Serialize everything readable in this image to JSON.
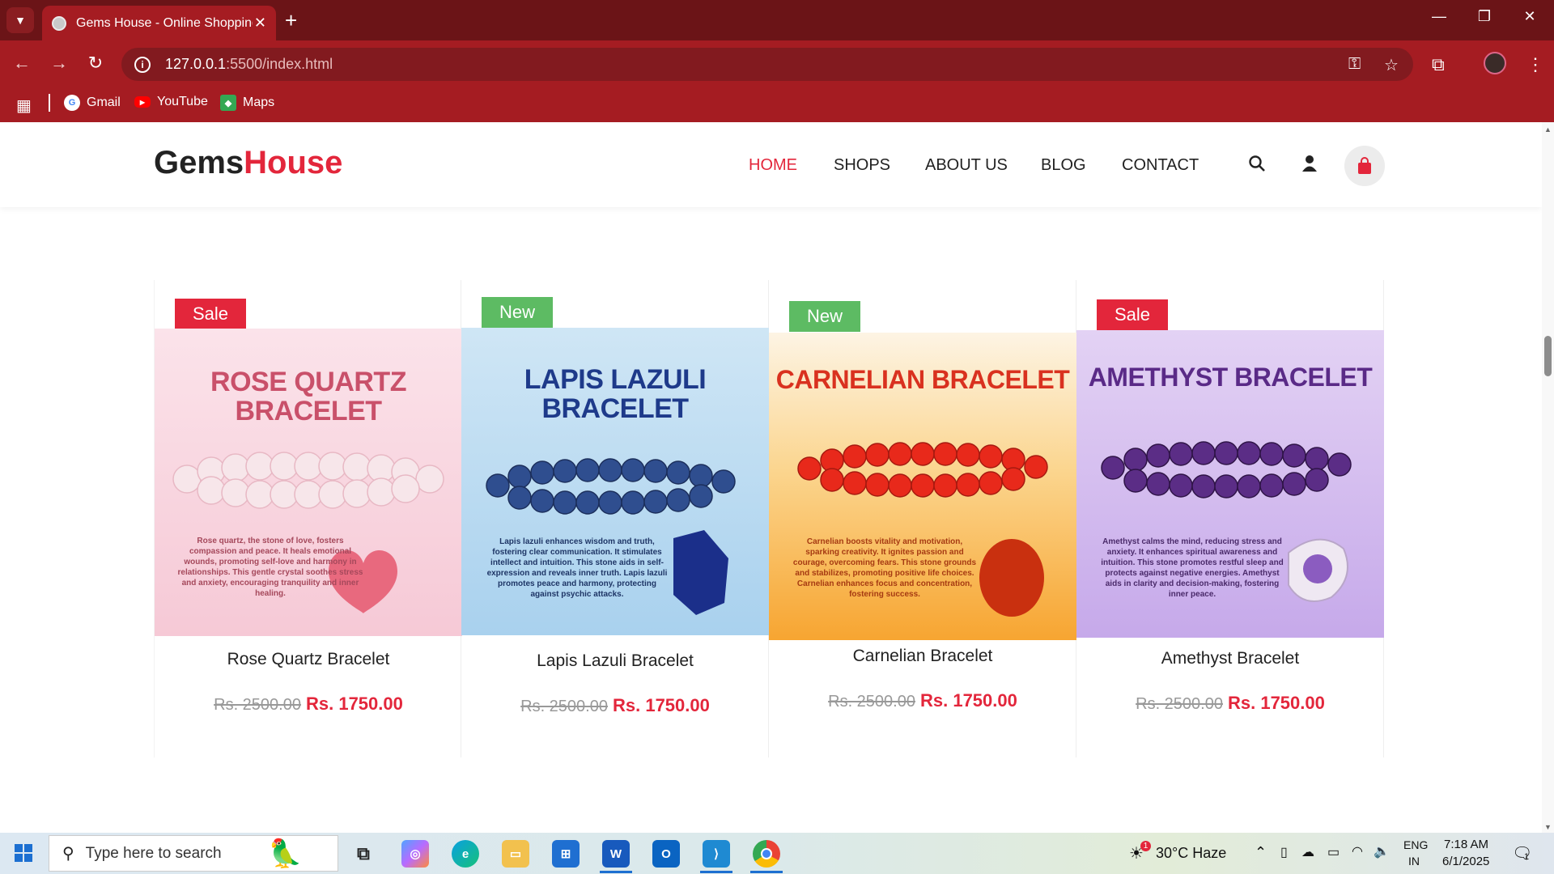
{
  "browser": {
    "tab_title": "Gems House - Online Shopping",
    "url_host": "127.0.0.1",
    "url_rest": ":5500/index.html",
    "bookmarks": [
      "Gmail",
      "YouTube",
      "Maps"
    ]
  },
  "site": {
    "logo_part1": "Gems",
    "logo_part2": "House",
    "nav": [
      "HOME",
      "SHOPS",
      "ABOUT US",
      "BLOG",
      "CONTACT"
    ],
    "active_nav": "HOME"
  },
  "products": [
    {
      "badge": "Sale",
      "image_title_line1": "ROSE QUARTZ",
      "image_title_line2": "BRACELET",
      "image_text": "Rose quartz, the stone of love, fosters compassion and peace. It heals emotional wounds, promoting self-love and harmony in relationships. This gentle crystal soothes stress and anxiety, encouraging tranquility and inner healing.",
      "name": "Rose Quartz Bracelet",
      "old_price": "Rs. 2500.00",
      "price": "Rs. 1750.00"
    },
    {
      "badge": "New",
      "image_title_line1": "LAPIS LAZULI",
      "image_title_line2": "BRACELET",
      "image_text": "Lapis lazuli enhances wisdom and truth, fostering clear communication. It stimulates intellect and intuition. This stone aids in self-expression and reveals inner truth. Lapis lazuli promotes peace and harmony, protecting against psychic attacks.",
      "name": "Lapis Lazuli Bracelet",
      "old_price": "Rs. 2500.00",
      "price": "Rs. 1750.00"
    },
    {
      "badge": "New",
      "image_title_line1": "CARNELIAN BRACELET",
      "image_title_line2": "",
      "image_text": "Carnelian boosts vitality and motivation, sparking creativity. It ignites passion and courage, overcoming fears. This stone grounds and stabilizes, promoting positive life choices. Carnelian enhances focus and concentration, fostering success.",
      "name": "Carnelian Bracelet",
      "old_price": "Rs. 2500.00",
      "price": "Rs. 1750.00"
    },
    {
      "badge": "Sale",
      "image_title_line1": "AMETHYST BRACELET",
      "image_title_line2": "",
      "image_text": "Amethyst calms the mind, reducing stress and anxiety. It enhances spiritual awareness and intuition. This stone promotes restful sleep and protects against negative energies. Amethyst aids in clarity and decision-making, fostering inner peace.",
      "name": "Amethyst Bracelet",
      "old_price": "Rs. 2500.00",
      "price": "Rs. 1750.00"
    }
  ],
  "taskbar": {
    "search_placeholder": "Type here to search",
    "weather": "30°C  Haze",
    "lang1": "ENG",
    "lang2": "IN",
    "time": "7:18 AM",
    "date": "6/1/2025",
    "notification_count": "1",
    "weather_badge": "1"
  },
  "colors": {
    "brand_red": "#e3263b",
    "badge_new": "#5dbb63",
    "chrome_dark": "#6b1417",
    "chrome_mid": "#a51c22"
  }
}
